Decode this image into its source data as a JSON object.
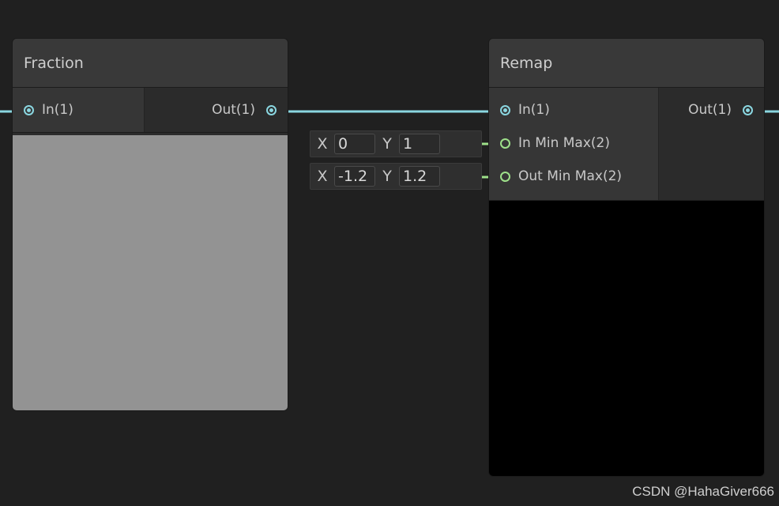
{
  "nodes": {
    "fraction": {
      "title": "Fraction",
      "input": "In(1)",
      "output": "Out(1)",
      "preview_color": "#939393"
    },
    "remap": {
      "title": "Remap",
      "inputs": [
        "In(1)",
        "In Min Max(2)",
        "Out Min Max(2)"
      ],
      "output": "Out(1)",
      "preview_color": "#000000"
    }
  },
  "fields": {
    "in_min_max": {
      "x_label": "X",
      "x_value": "0",
      "y_label": "Y",
      "y_value": "1"
    },
    "out_min_max": {
      "x_label": "X",
      "x_value": "-1.2",
      "y_label": "Y",
      "y_value": "1.2"
    }
  },
  "colors": {
    "wire_float": "#8ad6e0",
    "wire_vector2": "#9ee08a",
    "background": "#202020"
  },
  "watermark": "CSDN @HahaGiver666"
}
